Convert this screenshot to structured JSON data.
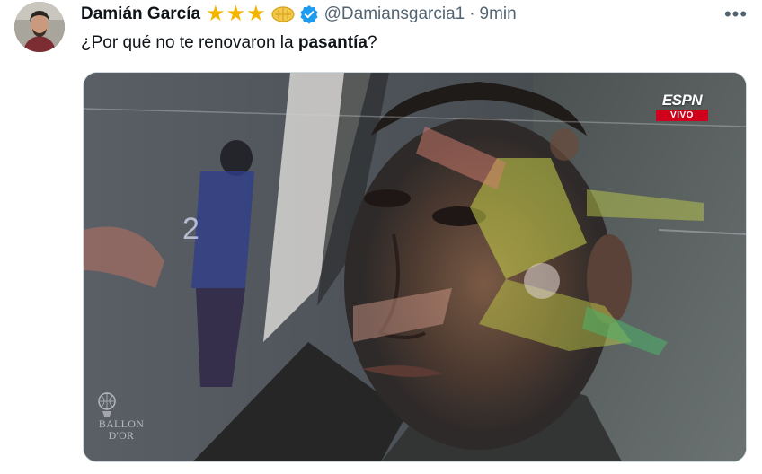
{
  "tweet": {
    "author_name": "Damián García",
    "handle": "@Damiansgarcia1",
    "separator": "·",
    "time": "9min",
    "more_label": "•••",
    "text_before": "¿Por qué no te renovaron la ",
    "text_bold": "pasantía",
    "text_after": "?",
    "badges": {
      "stars": [
        "★",
        "★",
        "★"
      ],
      "emoji_icon": "ballon-dor-emoji-icon",
      "verified_icon": "verified-badge-icon",
      "verified_color": "#1d9bf0",
      "star_color": "#f4b400"
    }
  },
  "media": {
    "description_icon": "video-frame",
    "broadcaster": {
      "logo": "ESPN",
      "live_label": "VIVO",
      "live_color": "#d0021b"
    },
    "watermark": {
      "line1": "BALLON",
      "line2": "D'OR"
    }
  }
}
